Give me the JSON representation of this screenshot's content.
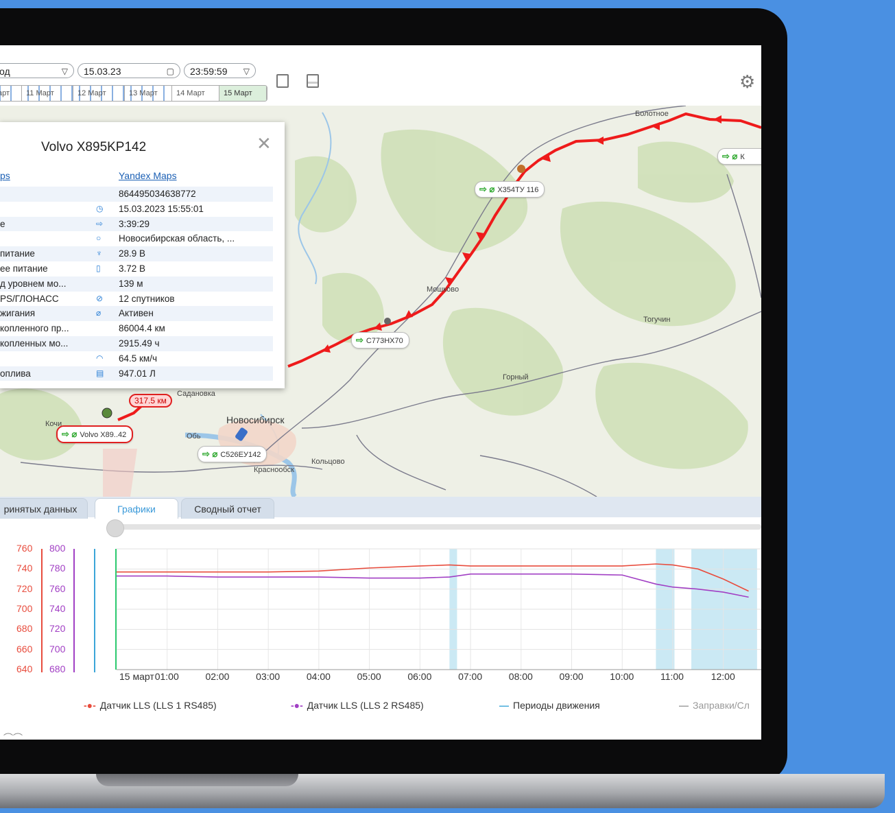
{
  "toolbar": {
    "period_text": "од",
    "date_value": "15.03.23",
    "time_value": "23:59:59",
    "days": [
      "арт",
      "11 Март",
      "12 Март",
      "13 Март",
      "14 Март",
      "15 Март"
    ]
  },
  "map": {
    "places": [
      "Болотное",
      "Мошково",
      "Тогучин",
      "Горный",
      "Новосибирск",
      "Обь",
      "Краснообск",
      "Кольцово",
      "Кочи",
      "Садановка"
    ],
    "vehicles": [
      "Х354ТУ 116",
      "С773НХ70",
      "Volvo X89..42",
      "С526ЕУ142",
      "К"
    ],
    "distance_label": "317.5 км"
  },
  "popup": {
    "title": "Volvo X895KP142",
    "link_left": "ps",
    "link_right": "Yandex Maps",
    "rows": [
      {
        "k": "",
        "icon": "",
        "v": "864495034638772"
      },
      {
        "k": "",
        "icon": "clock-icon",
        "v": "15.03.2023 15:55:01"
      },
      {
        "k": "е",
        "icon": "arrow-icon",
        "v": "3:39:29"
      },
      {
        "k": "",
        "icon": "location-icon",
        "v": "Новосибирская область, ..."
      },
      {
        "k": "питание",
        "icon": "plug-icon",
        "v": "28.9 В"
      },
      {
        "k": "ее питание",
        "icon": "battery-icon",
        "v": "3.72 В"
      },
      {
        "k": "д уровнем мо...",
        "icon": "",
        "v": "139 м"
      },
      {
        "k": "PS/ГЛОНАСС",
        "icon": "satellite-icon",
        "v": "12 спутников"
      },
      {
        "k": "жигания",
        "icon": "key-icon",
        "v": "Активен"
      },
      {
        "k": "копленного пр...",
        "icon": "",
        "v": "86004.4 км"
      },
      {
        "k": "копленных мо...",
        "icon": "",
        "v": "2915.49 ч"
      },
      {
        "k": "",
        "icon": "speed-icon",
        "v": "64.5 км/ч"
      },
      {
        "k": "оплива",
        "icon": "fuel-icon",
        "v": "947.01 Л"
      }
    ]
  },
  "tabs": {
    "t1": "ринятых данных",
    "t2": "Графики",
    "t3": "Сводный отчет"
  },
  "chart": {
    "axis_left": [
      "760",
      "740",
      "720",
      "700",
      "680",
      "660",
      "640"
    ],
    "axis_right": [
      "800",
      "780",
      "760",
      "740",
      "720",
      "700",
      "680"
    ],
    "xticks": [
      "15 март",
      "01:00",
      "02:00",
      "03:00",
      "04:00",
      "05:00",
      "06:00",
      "07:00",
      "08:00",
      "09:00",
      "10:00",
      "11:00",
      "12:00"
    ],
    "legend": {
      "s1": "Датчик LLS (LLS 1 RS485)",
      "s2": "Датчик LLS (LLS 2 RS485)",
      "s3": "Периоды движения",
      "s4": "Заправки/Сл"
    },
    "colors": {
      "s1": "#e84c3d",
      "s2": "#a13fc4",
      "s3": "#3aa5d8",
      "s4": "#999999"
    }
  },
  "chart_data": {
    "type": "line",
    "title": "",
    "x": [
      "00:00",
      "01:00",
      "02:00",
      "03:00",
      "04:00",
      "05:00",
      "06:00",
      "06:35",
      "07:00",
      "08:00",
      "09:00",
      "10:00",
      "10:40",
      "11:00",
      "11:30",
      "12:00",
      "12:30"
    ],
    "series": [
      {
        "name": "Датчик LLS (LLS 1 RS485)",
        "axis": "left",
        "values": [
          737,
          737,
          737,
          737,
          738,
          741,
          743,
          744,
          743,
          743,
          743,
          743,
          745,
          744,
          740,
          730,
          718
        ]
      },
      {
        "name": "Датчик LLS (LLS 2 RS485)",
        "axis": "right",
        "values": [
          773,
          773,
          772,
          772,
          772,
          771,
          771,
          772,
          775,
          775,
          775,
          774,
          765,
          762,
          760,
          757,
          752
        ]
      }
    ],
    "ylim_left": [
      640,
      760
    ],
    "ylim_right": [
      680,
      800
    ],
    "movement_periods": [
      [
        "06:35",
        "06:44"
      ],
      [
        "10:40",
        "11:02"
      ],
      [
        "11:22",
        "12:40"
      ]
    ]
  }
}
